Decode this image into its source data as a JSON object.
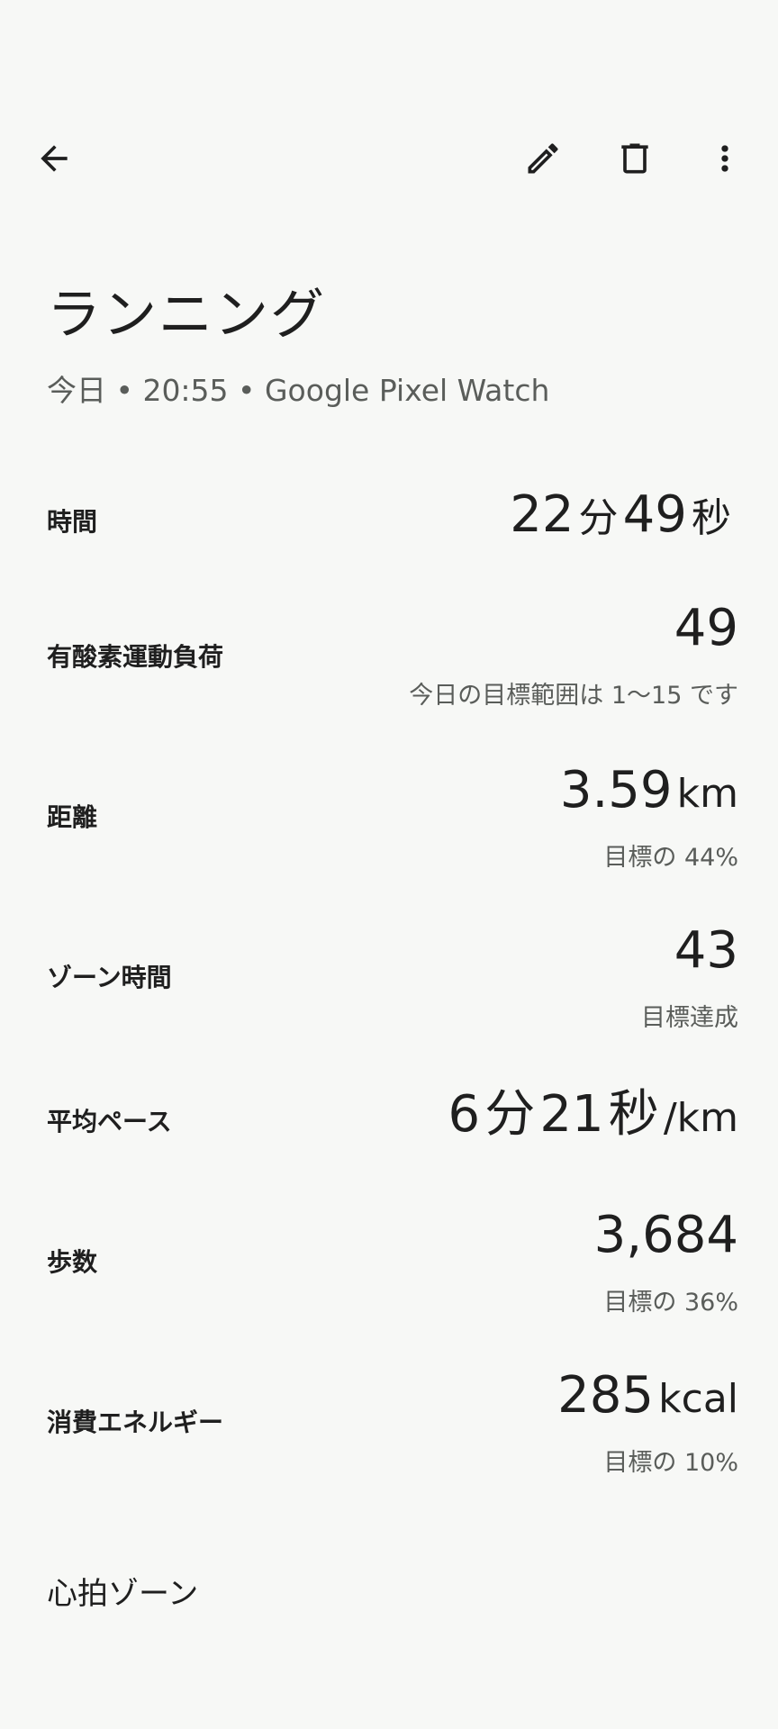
{
  "header": {
    "title": "ランニング",
    "subtitle": "今日 • 20:55 • Google Pixel Watch"
  },
  "icons": {
    "back": "arrow-back-icon",
    "edit": "pencil-icon",
    "delete": "trash-icon",
    "more": "more-vert-icon"
  },
  "stats": {
    "duration": {
      "label": "時間",
      "min_value": "22",
      "min_unit": "分",
      "sec_value": "49",
      "sec_unit": "秒"
    },
    "cardio_load": {
      "label": "有酸素運動負荷",
      "value": "49",
      "sub": "今日の目標範囲は 1〜15 です"
    },
    "distance": {
      "label": "距離",
      "value": "3.59",
      "unit": "km",
      "sub": "目標の 44%"
    },
    "zone_minutes": {
      "label": "ゾーン時間",
      "value": "43",
      "sub": "目標達成"
    },
    "avg_pace": {
      "label": "平均ペース",
      "min_value": "6",
      "min_unit": "分",
      "sec_value": "21",
      "sec_unit": "秒",
      "per_unit": "/km"
    },
    "steps": {
      "label": "歩数",
      "value": "3,684",
      "sub": "目標の 36%"
    },
    "energy": {
      "label": "消費エネルギー",
      "value": "285",
      "unit": "kcal",
      "sub": "目標の 10%"
    }
  },
  "sections": {
    "heart_rate_zones": "心拍ゾーン"
  }
}
